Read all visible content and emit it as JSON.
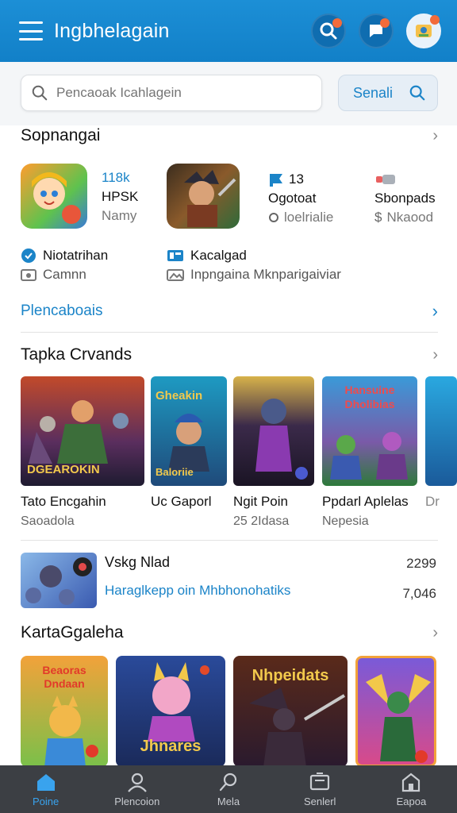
{
  "header": {
    "title": "Ingbhelagain",
    "icons": [
      "search-badge-icon",
      "chat-icon",
      "avatar-icon"
    ],
    "accent": "#1280c8"
  },
  "search": {
    "placeholder": "Pencaoak Icahlagein",
    "button_label": "Senali"
  },
  "section1": {
    "title": "Sopnangai",
    "featured": [
      {
        "line1": "118k",
        "line2": "HPSK",
        "line3": "Namy"
      },
      {
        "line1": "13",
        "line2": "Ogotoat",
        "line3": "loelrialie"
      },
      {
        "line1": "",
        "line2": "Sbonpads",
        "line3": "Nkaood"
      }
    ],
    "ratings": [
      {
        "line1": "Niotatrihan",
        "line2": "Camnn"
      },
      {
        "line1": "Kacalgad",
        "line2": "Inpngaina Mknparigaiviar"
      }
    ],
    "link_label": "Plencaboais"
  },
  "section2": {
    "title": "Tapka Crvands",
    "cards": [
      {
        "art_text": "DGEAROKIN",
        "name": "Tato Encgahin",
        "sub": "Saoadola"
      },
      {
        "art_text": "Gheakin",
        "art_text2": "Baloriie",
        "name": "Uc Gaporl",
        "sub": ""
      },
      {
        "art_text": "",
        "name": "Ngit Poin",
        "sub": "25 2Idasa"
      },
      {
        "art_text": "Hansuine Dholibias",
        "name": "Ppdarl Aplelas",
        "sub": "Nepesia"
      },
      {
        "art_text": "",
        "name": "Dr",
        "sub": ""
      }
    ]
  },
  "promo": {
    "title": "Vskg Nlad",
    "subtitle": "Haraglkepp oin Mhbhonohatiks",
    "value1": "2299",
    "value2": "7,046"
  },
  "section3": {
    "title": "KartaGgaleha",
    "cards": [
      {
        "art_text": "Beaoras Dndaan"
      },
      {
        "art_text": "Jhnares"
      },
      {
        "art_text": "Nhpeidats"
      },
      {
        "art_text": ""
      }
    ]
  },
  "nav": [
    {
      "label": "Poine",
      "icon": "home-icon"
    },
    {
      "label": "Plencoion",
      "icon": "profile-icon"
    },
    {
      "label": "Mela",
      "icon": "search-icon"
    },
    {
      "label": "Senlerl",
      "icon": "tv-icon"
    },
    {
      "label": "Eapoa",
      "icon": "store-icon"
    }
  ]
}
